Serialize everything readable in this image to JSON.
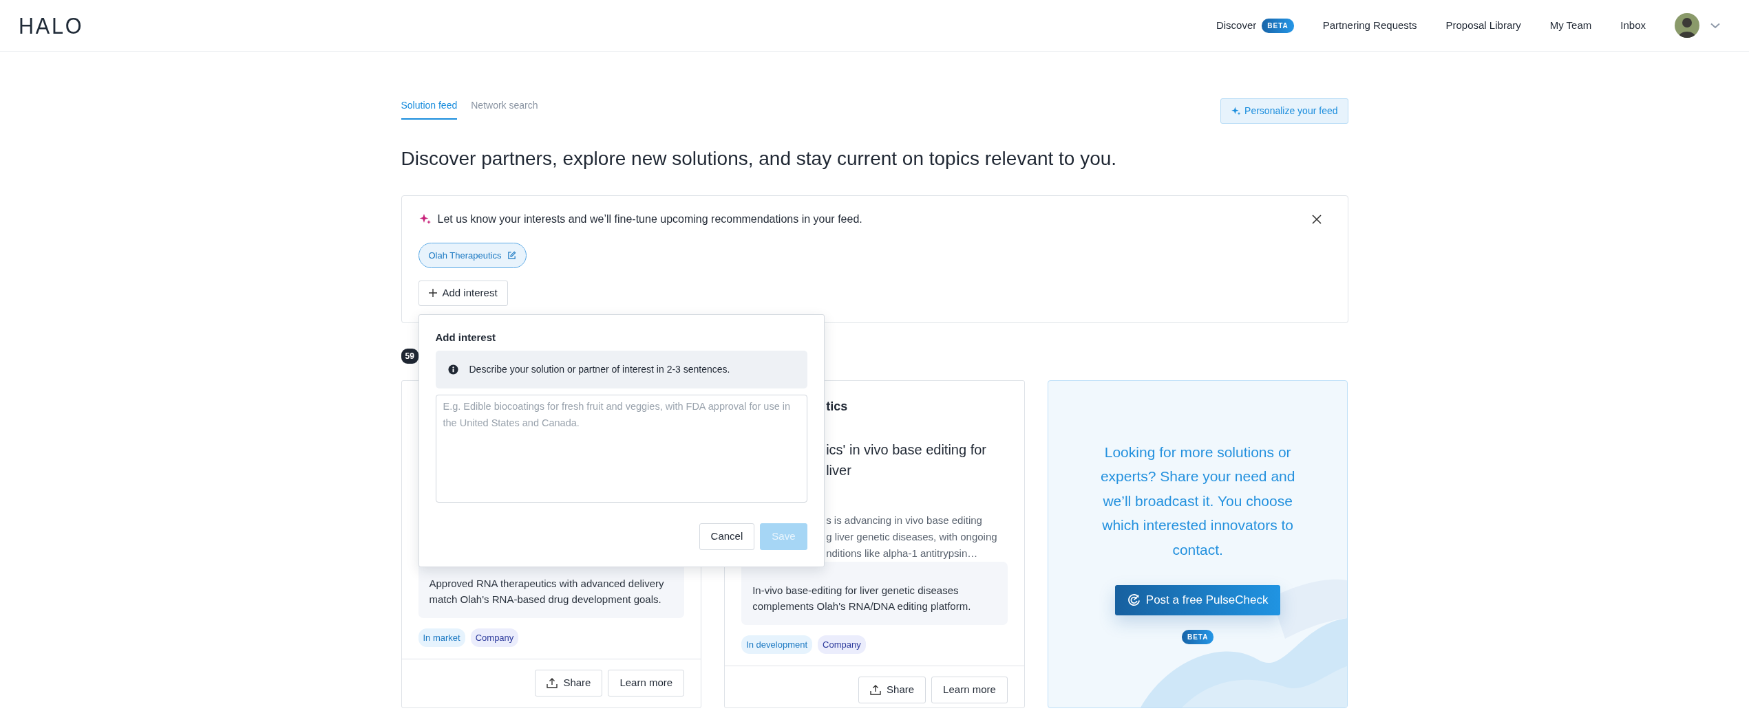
{
  "logo": "HALO",
  "nav": [
    {
      "label": "Discover",
      "badge": "BETA"
    },
    {
      "label": "Partnering Requests"
    },
    {
      "label": "Proposal Library"
    },
    {
      "label": "My Team"
    },
    {
      "label": "Inbox"
    }
  ],
  "tabs": [
    {
      "label": "Solution feed",
      "selected": true
    },
    {
      "label": "Network search",
      "selected": false
    }
  ],
  "personalize_button": "Personalize your feed",
  "heading": "Discover partners, explore new solutions, and stay current on topics relevant to you.",
  "interest_banner": {
    "message": "Let us know your interests and we’ll fine-tune upcoming recommendations in your feed.",
    "interests": [
      "Olah Therapeutics"
    ],
    "add_button": "Add interest"
  },
  "add_interest_popup": {
    "title": "Add interest",
    "info": "Describe your solution or partner of interest in 2-3 sentences.",
    "placeholder": "E.g. Edible biocoatings for fresh fruit and veggies, with FDA approval for use in the United States and Canada.",
    "cancel": "Cancel",
    "save": {
      "label": "Save",
      "disabled": true
    }
  },
  "results_count": "59",
  "cards": [
    {
      "relevance": "Approved RNA therapeutics with advanced delivery match Olah's RNA-based drug development goals.",
      "tags": [
        {
          "label": "In market",
          "kind": "stage"
        },
        {
          "label": "Company",
          "kind": "type"
        }
      ],
      "buttons": [
        "Share",
        "Learn more"
      ]
    },
    {
      "title": "tics",
      "headline": "ics' in vivo base editing for liver",
      "description": [
        "s is advancing in vivo base editing",
        "g liver genetic diseases, with ongoing",
        "nditions like alpha-1 antitrypsin…"
      ],
      "relevance": "In-vivo base-editing for liver genetic diseases complements Olah's RNA/DNA editing platform.",
      "tags": [
        {
          "label": "In development",
          "kind": "stage"
        },
        {
          "label": "Company",
          "kind": "type"
        }
      ],
      "buttons": [
        "Share",
        "Learn more"
      ]
    }
  ],
  "cta_card": {
    "message": "Looking for more solutions or experts? Share your need and we’ll broadcast it. You choose which interested innovators to contact.",
    "button": "Post a free PulseCheck",
    "badge": "BETA"
  }
}
